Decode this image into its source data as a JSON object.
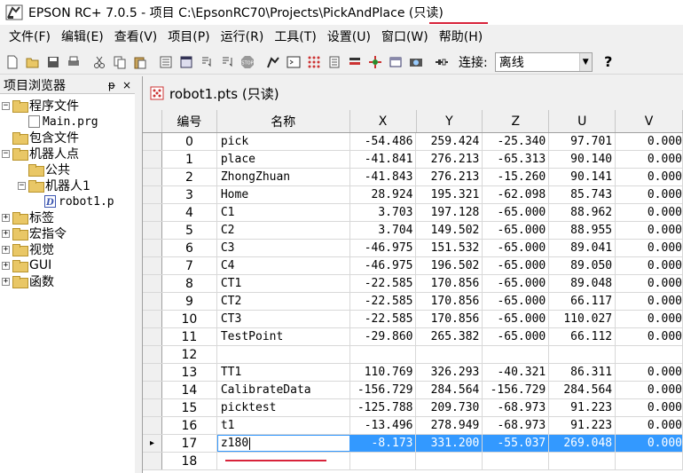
{
  "window": {
    "title": "EPSON RC+ 7.0.5 - 项目 C:\\EpsonRC70\\Projects\\PickAndPlace (只读)"
  },
  "menu": [
    "文件(F)",
    "编辑(E)",
    "查看(V)",
    "项目(P)",
    "运行(R)",
    "工具(T)",
    "设置(U)",
    "窗口(W)",
    "帮助(H)"
  ],
  "toolbar": {
    "icons": [
      "new-file-icon",
      "open-folder-icon",
      "save-all-icon",
      "print-icon",
      "cut-icon",
      "copy-icon",
      "paste-icon",
      "build-icon",
      "run-window-icon",
      "step-into-icon",
      "step-over-icon",
      "stop-icon",
      "robot-manager-icon",
      "command-window-icon",
      "io-monitor-icon",
      "task-manager-icon",
      "io-label-icon",
      "robot-icon",
      "vision-icon",
      "camera-icon",
      "connect-icon"
    ],
    "connection_label": "连接:",
    "connection_value": "离线",
    "help_label": "?"
  },
  "sidebar": {
    "title": "项目浏览器",
    "pin": "ᵽ",
    "close": "×",
    "tree": [
      {
        "label": "程序文件",
        "level": 0,
        "expander": "−",
        "icon": "folder"
      },
      {
        "label": "Main.prg",
        "level": 1,
        "expander": "",
        "icon": "file",
        "mono": true
      },
      {
        "label": "包含文件",
        "level": 0,
        "expander": "",
        "icon": "folder"
      },
      {
        "label": "机器人点",
        "level": 0,
        "expander": "−",
        "icon": "folder"
      },
      {
        "label": "公共",
        "level": 1,
        "expander": "",
        "icon": "folder"
      },
      {
        "label": "机器人1",
        "level": 1,
        "expander": "−",
        "icon": "folder"
      },
      {
        "label": "robot1.p",
        "level": 2,
        "expander": "",
        "icon": "pts",
        "mono": true
      },
      {
        "label": "标签",
        "level": 0,
        "expander": "+",
        "icon": "folder"
      },
      {
        "label": "宏指令",
        "level": 0,
        "expander": "+",
        "icon": "folder"
      },
      {
        "label": "视觉",
        "level": 0,
        "expander": "+",
        "icon": "folder"
      },
      {
        "label": "GUI",
        "level": 0,
        "expander": "+",
        "icon": "folder"
      },
      {
        "label": "函数",
        "level": 0,
        "expander": "+",
        "icon": "folder"
      }
    ]
  },
  "document": {
    "title": "robot1.pts (只读)",
    "columns": [
      "编号",
      "名称",
      "X",
      "Y",
      "Z",
      "U",
      "V"
    ],
    "rows": [
      {
        "num": "0",
        "name": "pick",
        "x": "-54.486",
        "y": "259.424",
        "z": "-25.340",
        "u": "97.701",
        "v": "0.000"
      },
      {
        "num": "1",
        "name": "place",
        "x": "-41.841",
        "y": "276.213",
        "z": "-65.313",
        "u": "90.140",
        "v": "0.000"
      },
      {
        "num": "2",
        "name": "ZhongZhuan",
        "x": "-41.843",
        "y": "276.213",
        "z": "-15.260",
        "u": "90.141",
        "v": "0.000"
      },
      {
        "num": "3",
        "name": "Home",
        "x": "28.924",
        "y": "195.321",
        "z": "-62.098",
        "u": "85.743",
        "v": "0.000"
      },
      {
        "num": "4",
        "name": "C1",
        "x": "3.703",
        "y": "197.128",
        "z": "-65.000",
        "u": "88.962",
        "v": "0.000"
      },
      {
        "num": "5",
        "name": "C2",
        "x": "3.704",
        "y": "149.502",
        "z": "-65.000",
        "u": "88.955",
        "v": "0.000"
      },
      {
        "num": "6",
        "name": "C3",
        "x": "-46.975",
        "y": "151.532",
        "z": "-65.000",
        "u": "89.041",
        "v": "0.000"
      },
      {
        "num": "7",
        "name": "C4",
        "x": "-46.975",
        "y": "196.502",
        "z": "-65.000",
        "u": "89.050",
        "v": "0.000"
      },
      {
        "num": "8",
        "name": "CT1",
        "x": "-22.585",
        "y": "170.856",
        "z": "-65.000",
        "u": "89.048",
        "v": "0.000"
      },
      {
        "num": "9",
        "name": "CT2",
        "x": "-22.585",
        "y": "170.856",
        "z": "-65.000",
        "u": "66.117",
        "v": "0.000"
      },
      {
        "num": "10",
        "name": "CT3",
        "x": "-22.585",
        "y": "170.856",
        "z": "-65.000",
        "u": "110.027",
        "v": "0.000"
      },
      {
        "num": "11",
        "name": "TestPoint",
        "x": "-29.860",
        "y": "265.382",
        "z": "-65.000",
        "u": "66.112",
        "v": "0.000"
      },
      {
        "num": "12",
        "name": "",
        "x": "",
        "y": "",
        "z": "",
        "u": "",
        "v": ""
      },
      {
        "num": "13",
        "name": "TT1",
        "x": "110.769",
        "y": "326.293",
        "z": "-40.321",
        "u": "86.311",
        "v": "0.000"
      },
      {
        "num": "14",
        "name": "CalibrateData",
        "x": "-156.729",
        "y": "284.564",
        "z": "-156.729",
        "u": "284.564",
        "v": "0.000"
      },
      {
        "num": "15",
        "name": "picktest",
        "x": "-125.788",
        "y": "209.730",
        "z": "-68.973",
        "u": "91.223",
        "v": "0.000"
      },
      {
        "num": "16",
        "name": "t1",
        "x": "-13.496",
        "y": "278.949",
        "z": "-68.973",
        "u": "91.223",
        "v": "0.000"
      },
      {
        "num": "17",
        "name": "z180",
        "x": "-8.173",
        "y": "331.200",
        "z": "-55.037",
        "u": "269.048",
        "v": "0.000",
        "selected": true
      },
      {
        "num": "18",
        "name": "",
        "x": "",
        "y": "",
        "z": "",
        "u": "",
        "v": ""
      }
    ],
    "selected_marker": "▸"
  }
}
